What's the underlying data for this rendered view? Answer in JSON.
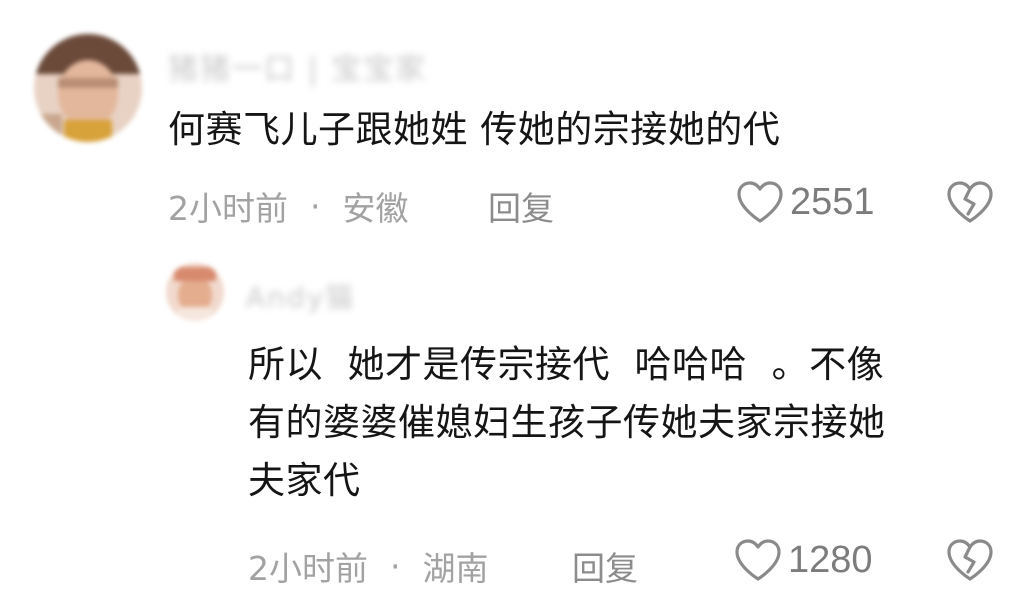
{
  "comments": [
    {
      "username": "猪猪一口 | 宝宝家",
      "content": "何赛飞儿子跟她姓 传她的宗接她的代",
      "time": "2小时前",
      "separator": "·",
      "location": "安徽",
      "reply_label": "回复",
      "like_count": "2551"
    },
    {
      "username": "Andy猫",
      "content": "所以  她才是传宗接代  哈哈哈  。不像\n有的婆婆催媳妇生孩子传她夫家宗接她\n夫家代",
      "time": "2小时前",
      "separator": "·",
      "location": "湖南",
      "reply_label": "回复",
      "like_count": "1280"
    }
  ],
  "icons": {
    "like": "heart-outline-icon",
    "dislike": "broken-heart-icon"
  },
  "colors": {
    "content_text": "#151515",
    "meta_text": "#a2a2a2",
    "icon_stroke": "#8a8a8a"
  }
}
